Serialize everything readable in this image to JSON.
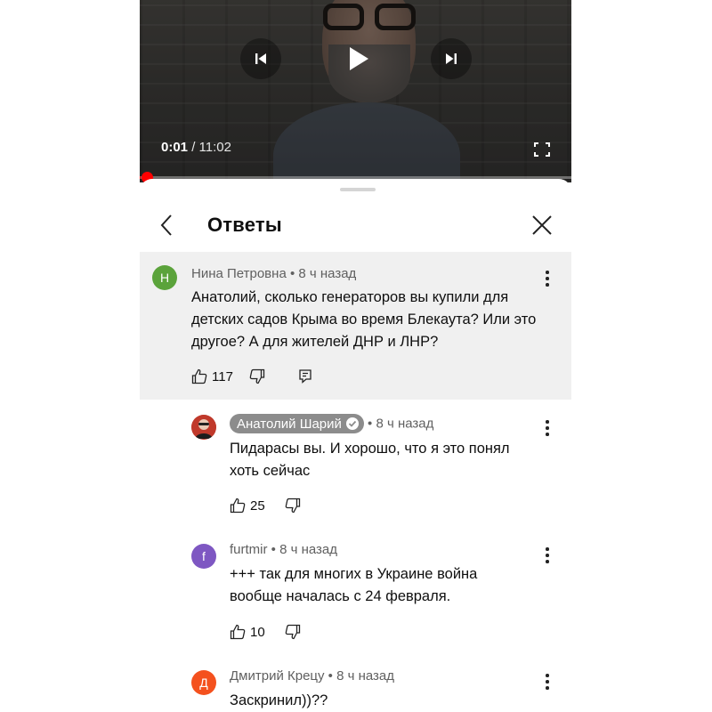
{
  "player": {
    "current_time": "0:01",
    "separator": " / ",
    "total_time": "11:02",
    "progress": 0.002,
    "icons": [
      "previous-icon",
      "play-icon",
      "next-icon",
      "fullscreen-icon"
    ]
  },
  "sheet": {
    "title": "Ответы",
    "icons": [
      "back-chevron-icon",
      "close-icon"
    ]
  },
  "comments": [
    {
      "avatar_letter": "Н",
      "avatar_color": "#5ba33b",
      "author": "Нина Петровна",
      "time": " • 8 ч назад",
      "text": "Анатолий, сколько генераторов вы купили для детских садов Крыма во время Блекаута? Или это другое? А для жителей ДНР и ЛНР?",
      "likes": "117"
    },
    {
      "avatar_letter": "",
      "avatar_color": "#c0392b",
      "author": "Анатолий Шарий",
      "verified": true,
      "time": " • 8 ч назад",
      "text": "Пидарасы вы. И хорошо, что я это понял хоть сейчас",
      "likes": "25"
    },
    {
      "avatar_letter": "f",
      "avatar_color": "#7e57c2",
      "author": "furtmir",
      "time": " • 8 ч назад",
      "text": "+++ так для многих в Украине война вообще началась с 24 февраля.",
      "likes": "10"
    },
    {
      "avatar_letter": "Д",
      "avatar_color": "#f4511e",
      "author": "Дмитрий Крецу",
      "time": " • 8 ч назад",
      "text": "Заскринил))??"
    }
  ]
}
